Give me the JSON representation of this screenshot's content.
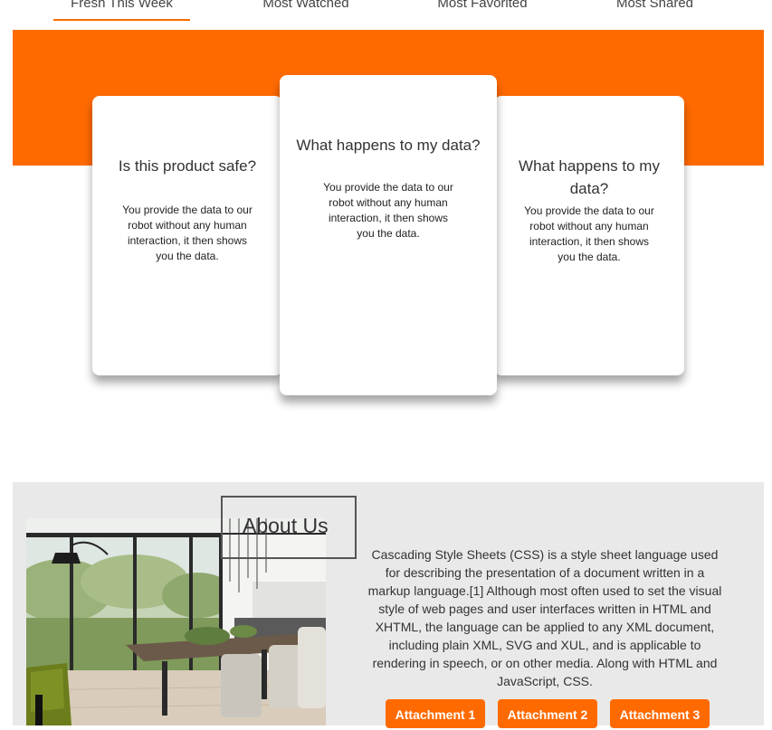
{
  "tabs": [
    {
      "label": "Fresh This Week",
      "active": true
    },
    {
      "label": "Most Watched",
      "active": false
    },
    {
      "label": "Most Favorited",
      "active": false
    },
    {
      "label": "Most Shared",
      "active": false
    }
  ],
  "cards": [
    {
      "title": "Is this product safe?",
      "body": "You provide the data to our robot without any human interaction, it then shows you the data."
    },
    {
      "title": "What happens to my data?",
      "body": "You provide the data to our robot without any human interaction, it then shows you the data."
    },
    {
      "title": "What happens to my data?",
      "body": "You provide the data to our robot without any human interaction, it then shows you the data."
    }
  ],
  "about": {
    "title": "About Us",
    "text": "Cascading Style Sheets (CSS) is a style sheet language used for describing the presentation of a document written in a markup language.[1] Although most often used to set the visual style of web pages and user interfaces written in HTML and XHTML, the language can be applied to any XML document, including plain XML, SVG and XUL, and is applicable to rendering in speech, or on other media. Along with HTML and JavaScript, CSS.",
    "attachments": [
      "Attachment 1",
      "Attachment 2",
      "Attachment 3"
    ]
  },
  "colors": {
    "accent": "#ff6a00",
    "about_bg": "#e9e9e9"
  }
}
